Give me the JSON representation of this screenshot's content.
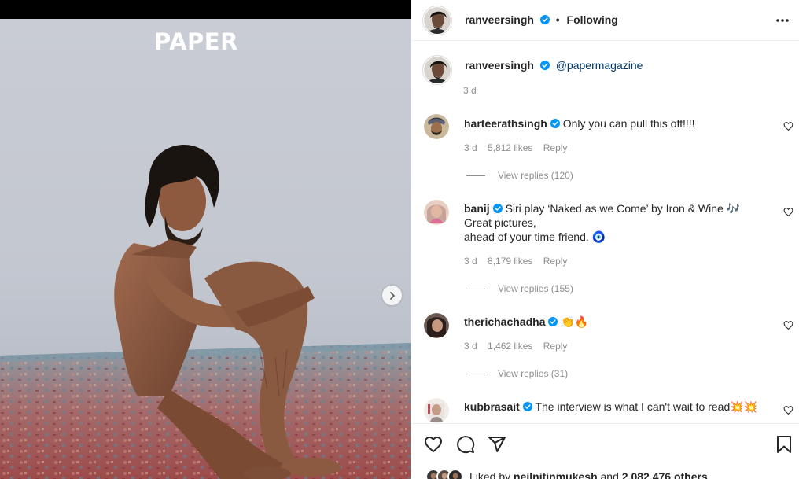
{
  "photo": {
    "magazine_logo": "PAPER",
    "next_button_icon": "chevron-right-icon"
  },
  "post": {
    "author": "ranveersingh",
    "follow_status": "Following",
    "separator": "•",
    "more_icon": "more-horizontal-icon",
    "verified_color": "#0095f6"
  },
  "caption": {
    "author": "ranveersingh",
    "mention": "@papermagazine",
    "time": "3 d"
  },
  "comments": [
    {
      "username": "harteerathsingh",
      "verified": true,
      "text": "Only you can pull this off!!!!",
      "time": "3 d",
      "likes": "5,812 likes",
      "reply_label": "Reply",
      "view_replies": "View replies (120)"
    },
    {
      "username": "banij",
      "verified": true,
      "text_line1": "Siri play ‘Naked as we Come’ by Iron & Wine 🎶",
      "text_line2": "Great pictures,",
      "text_line3": "ahead of your time friend. 🧿",
      "time": "3 d",
      "likes": "8,179 likes",
      "reply_label": "Reply",
      "view_replies": "View replies (155)"
    },
    {
      "username": "therichachadha",
      "verified": true,
      "text": "👏🔥",
      "time": "3 d",
      "likes": "1,462 likes",
      "reply_label": "Reply",
      "view_replies": "View replies (31)"
    },
    {
      "username": "kubbrasait",
      "verified": true,
      "text": "The interview is what I can't wait to read💥💥"
    }
  ],
  "actions": {
    "like_icon": "heart-icon",
    "comment_icon": "comment-icon",
    "share_icon": "send-icon",
    "save_icon": "bookmark-icon"
  },
  "liked_by": {
    "prefix": "Liked by",
    "user": "neilnitinmukesh",
    "middle": "and",
    "count": "2,082,476 others"
  }
}
